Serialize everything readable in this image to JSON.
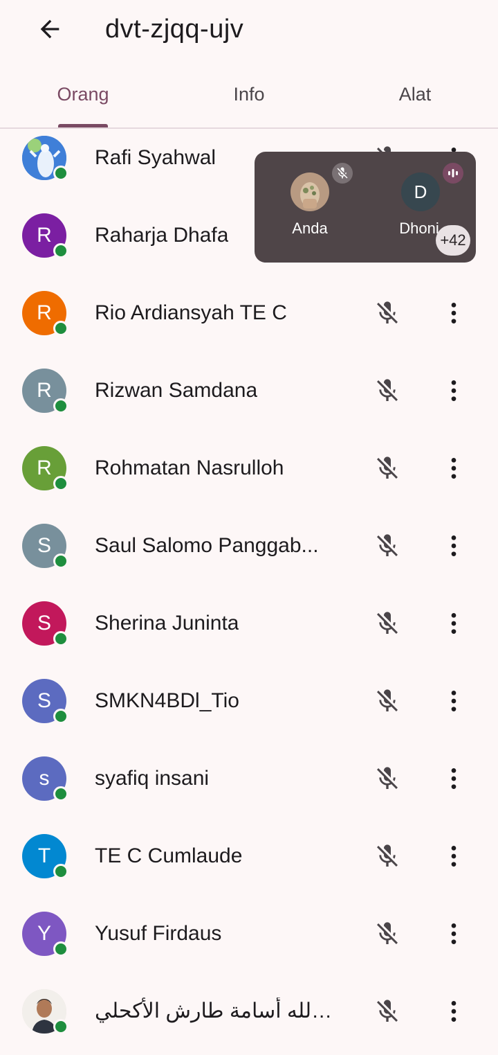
{
  "header": {
    "title": "dvt-zjqq-ujv"
  },
  "tabs": [
    {
      "label": "Orang",
      "active": true
    },
    {
      "label": "Info",
      "active": false
    },
    {
      "label": "Alat",
      "active": false
    }
  ],
  "colors": {
    "accent": "#7a4a63",
    "online": "#1e8e3e",
    "pip_bg": "#4f4548"
  },
  "participants": [
    {
      "name": "Rafi Syahwal",
      "initial": "",
      "avatar_type": "photo",
      "avatar_color": "#5b8fd6",
      "online": true,
      "muted": true
    },
    {
      "name": "Raharja Dhafa",
      "initial": "R",
      "avatar_type": "letter",
      "avatar_color": "#7b1fa2",
      "online": true,
      "muted": true
    },
    {
      "name": "Rio Ardiansyah TE C",
      "initial": "R",
      "avatar_type": "letter",
      "avatar_color": "#ef6c00",
      "online": true,
      "muted": true
    },
    {
      "name": "Rizwan Samdana",
      "initial": "R",
      "avatar_type": "letter",
      "avatar_color": "#78909c",
      "online": true,
      "muted": true
    },
    {
      "name": "Rohmatan Nasrulloh",
      "initial": "R",
      "avatar_type": "letter",
      "avatar_color": "#689f38",
      "online": true,
      "muted": true
    },
    {
      "name": "Saul Salomo Panggab...",
      "initial": "S",
      "avatar_type": "letter",
      "avatar_color": "#78909c",
      "online": true,
      "muted": true
    },
    {
      "name": "Sherina Juninta",
      "initial": "S",
      "avatar_type": "letter",
      "avatar_color": "#c2185b",
      "online": true,
      "muted": true
    },
    {
      "name": "SMKN4BDl_Tio",
      "initial": "S",
      "avatar_type": "letter",
      "avatar_color": "#5c6bc0",
      "online": true,
      "muted": true
    },
    {
      "name": "syafiq insani",
      "initial": "s",
      "avatar_type": "letter",
      "avatar_color": "#5c6bc0",
      "online": true,
      "muted": true
    },
    {
      "name": "TE C Cumlaude",
      "initial": "T",
      "avatar_type": "letter",
      "avatar_color": "#0288d1",
      "online": true,
      "muted": true
    },
    {
      "name": "Yusuf Firdaus",
      "initial": "Y",
      "avatar_type": "letter",
      "avatar_color": "#7e57c2",
      "online": true,
      "muted": true
    },
    {
      "name": "عبدالله أسامة طارش الأكحلي",
      "initial": "",
      "avatar_type": "photo",
      "avatar_color": "#e8e4e0",
      "online": true,
      "muted": true
    }
  ],
  "pip": {
    "tiles": [
      {
        "label": "Anda",
        "initial": "",
        "avatar_type": "photo",
        "muted": true
      },
      {
        "label": "Dhoni",
        "initial": "D",
        "avatar_type": "letter",
        "avatar_color": "#37474f",
        "speaking": true
      }
    ],
    "more_count": "+42"
  },
  "icons": {
    "back": "arrow-left-icon",
    "mic_off": "mic-off-icon",
    "more": "more-vert-icon"
  }
}
